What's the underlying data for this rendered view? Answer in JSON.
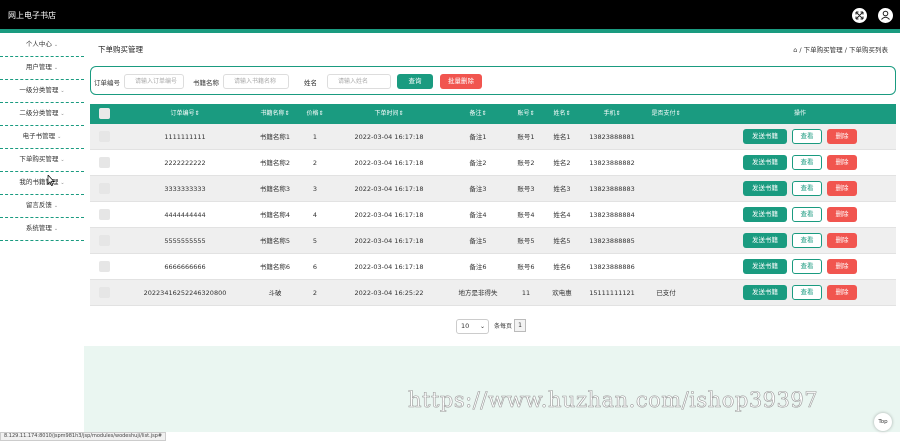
{
  "app": {
    "title": "网上电子书店"
  },
  "sidebar": {
    "items": [
      {
        "label": "个人中心"
      },
      {
        "label": "用户管理"
      },
      {
        "label": "一级分类管理"
      },
      {
        "label": "二级分类管理"
      },
      {
        "label": "电子书管理"
      },
      {
        "label": "下单购买管理"
      },
      {
        "label": "我的书籍管理"
      },
      {
        "label": "留言反馈"
      },
      {
        "label": "系统管理"
      }
    ]
  },
  "page": {
    "title": "下单购买管理",
    "breadcrumb": "⌂ / 下单购买管理 / 下单购买列表"
  },
  "search": {
    "order_label": "订单编号",
    "order_placeholder": "请输入订单编号",
    "book_label": "书籍名称",
    "book_placeholder": "请输入书籍名称",
    "name_label": "姓名",
    "name_placeholder": "请输入姓名",
    "query_btn": "查询",
    "batch_delete_btn": "批量删除"
  },
  "table": {
    "headers": [
      "订单编号",
      "书籍名称",
      "价格",
      "下单时间",
      "备注",
      "账号",
      "姓名",
      "手机",
      "是否支付",
      "操作"
    ],
    "rows": [
      {
        "order_no": "1111111111",
        "book": "书籍名称1",
        "price": "1",
        "time": "2022-03-04 16:17:18",
        "note": "备注1",
        "account": "账号1",
        "name": "姓名1",
        "phone": "13823888881",
        "paid": ""
      },
      {
        "order_no": "2222222222",
        "book": "书籍名称2",
        "price": "2",
        "time": "2022-03-04 16:17:18",
        "note": "备注2",
        "account": "账号2",
        "name": "姓名2",
        "phone": "13823888882",
        "paid": ""
      },
      {
        "order_no": "3333333333",
        "book": "书籍名称3",
        "price": "3",
        "time": "2022-03-04 16:17:18",
        "note": "备注3",
        "account": "账号3",
        "name": "姓名3",
        "phone": "13823888883",
        "paid": ""
      },
      {
        "order_no": "4444444444",
        "book": "书籍名称4",
        "price": "4",
        "time": "2022-03-04 16:17:18",
        "note": "备注4",
        "account": "账号4",
        "name": "姓名4",
        "phone": "13823888884",
        "paid": ""
      },
      {
        "order_no": "5555555555",
        "book": "书籍名称5",
        "price": "5",
        "time": "2022-03-04 16:17:18",
        "note": "备注5",
        "account": "账号5",
        "name": "姓名5",
        "phone": "13823888885",
        "paid": ""
      },
      {
        "order_no": "6666666666",
        "book": "书籍名称6",
        "price": "6",
        "time": "2022-03-04 16:17:18",
        "note": "备注6",
        "account": "账号6",
        "name": "姓名6",
        "phone": "13823888886",
        "paid": ""
      },
      {
        "order_no": "20223416252246320800",
        "book": "斗破",
        "price": "2",
        "time": "2022-03-04 16:25:22",
        "note": "地方是非得失",
        "account": "11",
        "name": "欢电惠",
        "phone": "15111111121",
        "paid": "已支付"
      }
    ],
    "actions": {
      "send": "发送书籍",
      "view": "查看",
      "delete": "删除"
    }
  },
  "pagination": {
    "page_size": "10",
    "page_size_label": "条每页",
    "current_page": "1"
  },
  "watermark": "https://www.huzhan.com/ishop39397",
  "top_button": "Top",
  "status_url": "8.129.11.174:8010/jspm981h3/jsp/modules/wodeshuji/list.jsp#",
  "colors": {
    "accent": "#1a9b80",
    "danger": "#f1554f",
    "header_bg": "#000000"
  }
}
